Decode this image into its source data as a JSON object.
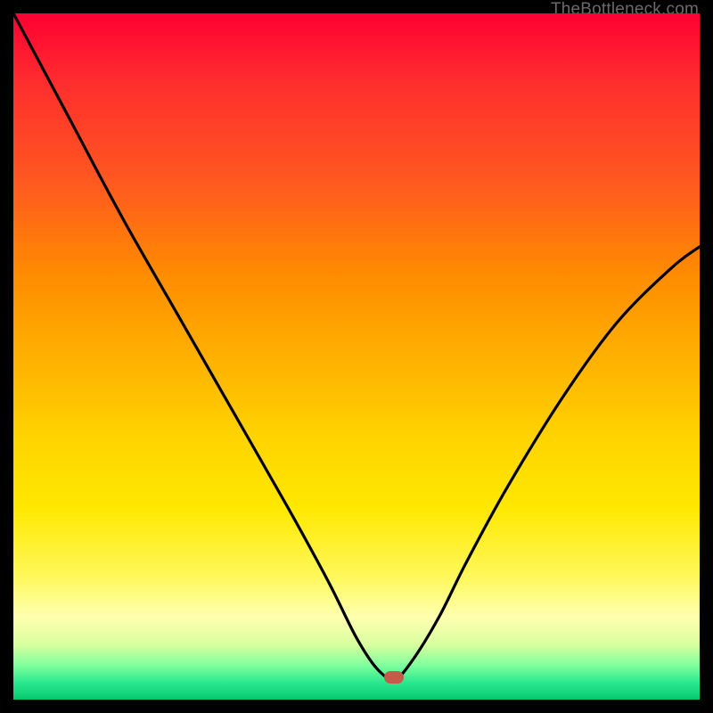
{
  "attribution": "TheBottleneck.com",
  "marker": {
    "x_frac": 0.555,
    "y_frac": 0.968,
    "color": "#c55a4a"
  },
  "chart_data": {
    "type": "line",
    "title": "",
    "xlabel": "",
    "ylabel": "",
    "xlim": [
      0,
      1
    ],
    "ylim": [
      0,
      1
    ],
    "series": [
      {
        "name": "bottleneck-curve",
        "x": [
          0.0,
          0.08,
          0.16,
          0.24,
          0.32,
          0.4,
          0.46,
          0.5,
          0.53,
          0.555,
          0.58,
          0.62,
          0.66,
          0.72,
          0.8,
          0.88,
          0.96,
          1.0
        ],
        "y": [
          1.0,
          0.85,
          0.7,
          0.56,
          0.42,
          0.28,
          0.17,
          0.09,
          0.045,
          0.03,
          0.055,
          0.12,
          0.2,
          0.31,
          0.44,
          0.55,
          0.63,
          0.66
        ]
      }
    ],
    "gradient_bands": [
      {
        "stop": 0.0,
        "color": "#ff0033"
      },
      {
        "stop": 0.5,
        "color": "#ffb000"
      },
      {
        "stop": 0.82,
        "color": "#fff85a"
      },
      {
        "stop": 0.95,
        "color": "#80ff9e"
      },
      {
        "stop": 1.0,
        "color": "#05c66d"
      }
    ],
    "optimum_marker": {
      "x": 0.555,
      "y": 0.03
    }
  }
}
